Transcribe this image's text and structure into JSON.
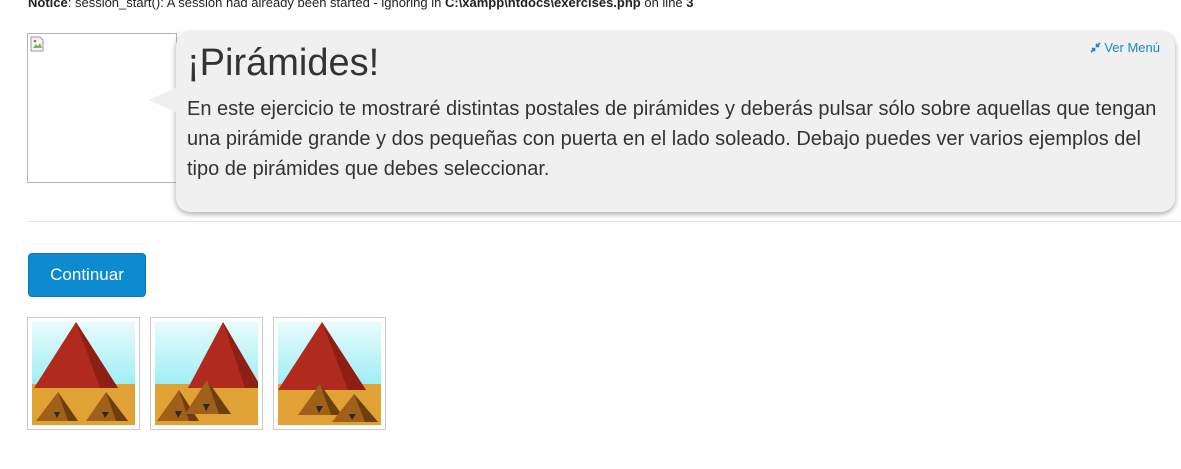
{
  "notice": {
    "label": "Notice",
    "text": ": session_start(): A session had already been started - ignoring in ",
    "file": "C:\\xampp\\htdocs\\exercises.php",
    "on_line": " on line ",
    "line": "3"
  },
  "bubble": {
    "menu_link": "Ver Menú",
    "title": "¡Pirámides!",
    "body": "En este ejercicio te mostraré distintas postales de pirámides y deberás pulsar sólo sobre aquellas que tengan una pirámide grande y dos pequeñas con puerta en el lado soleado. Debajo puedes ver varios ejemplos del tipo de pirámides que debes seleccionar."
  },
  "actions": {
    "continue_label": "Continuar"
  },
  "examples": {
    "count": 3,
    "colors": {
      "sky_top": "#e8fbfb",
      "sky_bottom": "#6fe6f2",
      "sand": "#e0a234",
      "big_pyramid": "#b02a1e",
      "small_pyramid": "#9a5a16",
      "link": "#1a86c8",
      "button": "#0c8bd1"
    }
  }
}
